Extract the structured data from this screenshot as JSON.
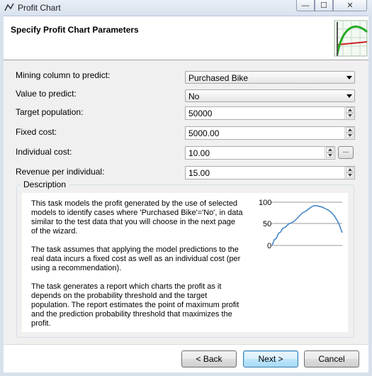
{
  "window": {
    "title": "Profit Chart",
    "controls": {
      "minimize": "—",
      "maximize": "☐",
      "close": "✕"
    }
  },
  "header": {
    "title": "Specify Profit Chart Parameters",
    "graphic_icon": "profit-chart-graphic"
  },
  "form": {
    "mining_column": {
      "label": "Mining column to predict:",
      "value": "Purchased Bike"
    },
    "value_to_predict": {
      "label": "Value to predict:",
      "value": "No"
    },
    "target_population": {
      "label": "Target population:",
      "value": "50000"
    },
    "fixed_cost": {
      "label": "Fixed cost:",
      "value": "5000.00"
    },
    "individual_cost": {
      "label": "Individual cost:",
      "value": "10.00",
      "browse_label": "..."
    },
    "revenue": {
      "label": "Revenue per individual:",
      "value": "15.00"
    }
  },
  "description": {
    "legend": "Description",
    "paragraphs": [
      "This task models the profit generated by the use of selected models to identify cases where 'Purchased Bike'='No', in data similar to the test data that you will choose in the next page of the wizard.",
      "The task assumes that applying the model predictions to the real data incurs a fixed cost as well as an individual cost (per using a recommendation).",
      "The task generates a report which charts the profit as it depends on the probability threshold and the target population. The report estimates the point of maximum profit and the prediction probability threshold that maximizes the profit."
    ],
    "chart": {
      "y_ticks": [
        "100",
        "50",
        "0"
      ],
      "line_color": "#3a7fc4"
    }
  },
  "buttons": {
    "back": "< Back",
    "next": "Next >",
    "cancel": "Cancel"
  }
}
